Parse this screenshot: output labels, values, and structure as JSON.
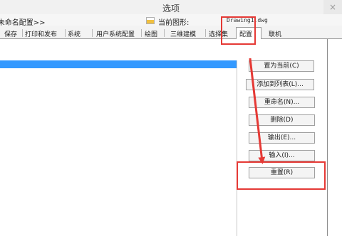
{
  "window": {
    "title": "选项",
    "close_label": "×"
  },
  "infobar": {
    "profile_label": "<<未命名配置>>",
    "current_drawing_label": "当前图形:",
    "current_drawing_value": "Drawing1.dwg"
  },
  "tabs": [
    {
      "label": "保存"
    },
    {
      "label": "打印和发布"
    },
    {
      "label": "系统"
    },
    {
      "label": "用户系统配置"
    },
    {
      "label": "绘图"
    },
    {
      "label": "三维建模"
    },
    {
      "label": "选择集"
    },
    {
      "label": "配置",
      "active": true
    },
    {
      "label": "联机"
    }
  ],
  "buttons": {
    "set_current": "置为当前(C)",
    "add_to_list": "添加到列表(L)...",
    "rename": "重命名(N)...",
    "delete": "删除(D)",
    "export": "输出(E)...",
    "import": "输入(I)...",
    "reset": "重置(R)"
  },
  "colors": {
    "highlight": "#e53935",
    "selection": "#3399ff"
  },
  "icons": {
    "drawing": "drawing-file-icon",
    "close": "close-icon"
  }
}
